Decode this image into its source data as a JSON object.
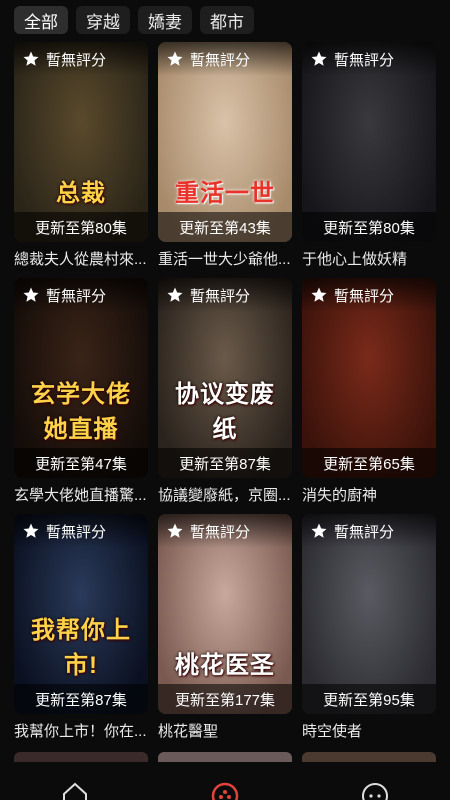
{
  "tabs": [
    {
      "label": "全部",
      "active": true
    },
    {
      "label": "穿越"
    },
    {
      "label": "嬌妻"
    },
    {
      "label": "都市"
    }
  ],
  "cards": [
    {
      "rating": "暫無評分",
      "episode": "更新至第80集",
      "title": "總裁夫人從農村來...",
      "overlay": "总裁",
      "overlay_style": "yellow",
      "colors": [
        "#5a4a2c",
        "#2a2418"
      ]
    },
    {
      "rating": "暫無評分",
      "episode": "更新至第43集",
      "title": "重活一世大少爺他...",
      "overlay": "重活一世",
      "overlay_style": "red",
      "colors": [
        "#d9c2a8",
        "#a78a6a"
      ]
    },
    {
      "rating": "暫無評分",
      "episode": "更新至第80集",
      "title": "于他心上做妖精",
      "overlay": "",
      "overlay_style": "white",
      "colors": [
        "#3a3a3e",
        "#16161a"
      ]
    },
    {
      "rating": "暫無評分",
      "episode": "更新至第47集",
      "title": "玄學大佬她直播驚...",
      "overlay": "玄学大佬她直播",
      "overlay_style": "yellow",
      "colors": [
        "#3a2418",
        "#140c08"
      ]
    },
    {
      "rating": "暫無評分",
      "episode": "更新至第87集",
      "title": "協議變廢紙，京圈...",
      "overlay": "协议变废纸",
      "overlay_style": "white",
      "colors": [
        "#6a5a4a",
        "#2a221c"
      ]
    },
    {
      "rating": "暫無評分",
      "episode": "更新至第65集",
      "title": "消失的廚神",
      "overlay": "",
      "overlay_style": "yellow",
      "colors": [
        "#7a2a1a",
        "#3a120a"
      ]
    },
    {
      "rating": "暫無評分",
      "episode": "更新至第87集",
      "title": "我幫你上市！你在...",
      "overlay": "我帮你上市!",
      "overlay_style": "yellow",
      "colors": [
        "#2a3a5a",
        "#0a1020"
      ]
    },
    {
      "rating": "暫無評分",
      "episode": "更新至第177集",
      "title": "桃花醫聖",
      "overlay": "桃花医圣",
      "overlay_style": "white",
      "colors": [
        "#c8a89c",
        "#7a5a50"
      ]
    },
    {
      "rating": "暫無評分",
      "episode": "更新至第95集",
      "title": "時空使者",
      "overlay": "",
      "overlay_style": "white",
      "colors": [
        "#5a5a62",
        "#2a2a30"
      ]
    }
  ],
  "theme": {
    "accent": "#e0443a",
    "background": "#0b0b0b"
  },
  "nav": [
    {
      "icon": "home-icon"
    },
    {
      "icon": "discover-icon"
    },
    {
      "icon": "chat-icon"
    }
  ]
}
